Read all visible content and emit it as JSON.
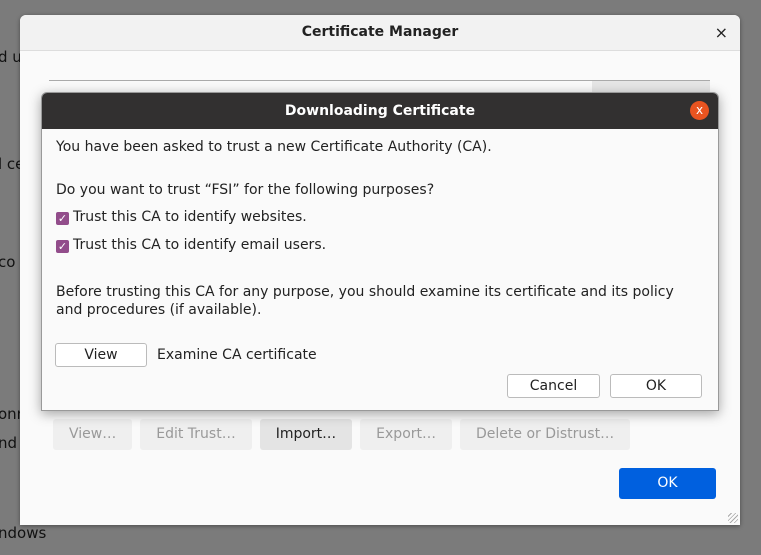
{
  "background_fragments": [
    "d u",
    "l ce",
    "co",
    "onn",
    "nd",
    "ndows"
  ],
  "manager": {
    "title": "Certificate Manager",
    "close_icon": "×",
    "buttons": [
      {
        "label": "View…",
        "enabled": false
      },
      {
        "label": "Edit Trust…",
        "enabled": false
      },
      {
        "label": "Import…",
        "enabled": true
      },
      {
        "label": "Export…",
        "enabled": false
      },
      {
        "label": "Delete or Distrust…",
        "enabled": false
      }
    ],
    "ok_label": "OK",
    "accent": "#0060df"
  },
  "dialog": {
    "title": "Downloading Certificate",
    "close_icon": "x",
    "close_color": "#e95420",
    "intro": "You have been asked to trust a new Certificate Authority (CA).",
    "question": "Do you want to trust “FSI” for the following purposes?",
    "checkboxes": [
      {
        "label": "Trust this CA to identify websites.",
        "checked": true
      },
      {
        "label": "Trust this CA to identify email users.",
        "checked": true
      }
    ],
    "checkbox_color": "#924d8b",
    "advice": "Before trusting this CA for any purpose, you should examine its certificate and its policy and procedures (if available).",
    "view_label": "View",
    "view_desc": "Examine CA certificate",
    "cancel_label": "Cancel",
    "ok_label": "OK"
  }
}
